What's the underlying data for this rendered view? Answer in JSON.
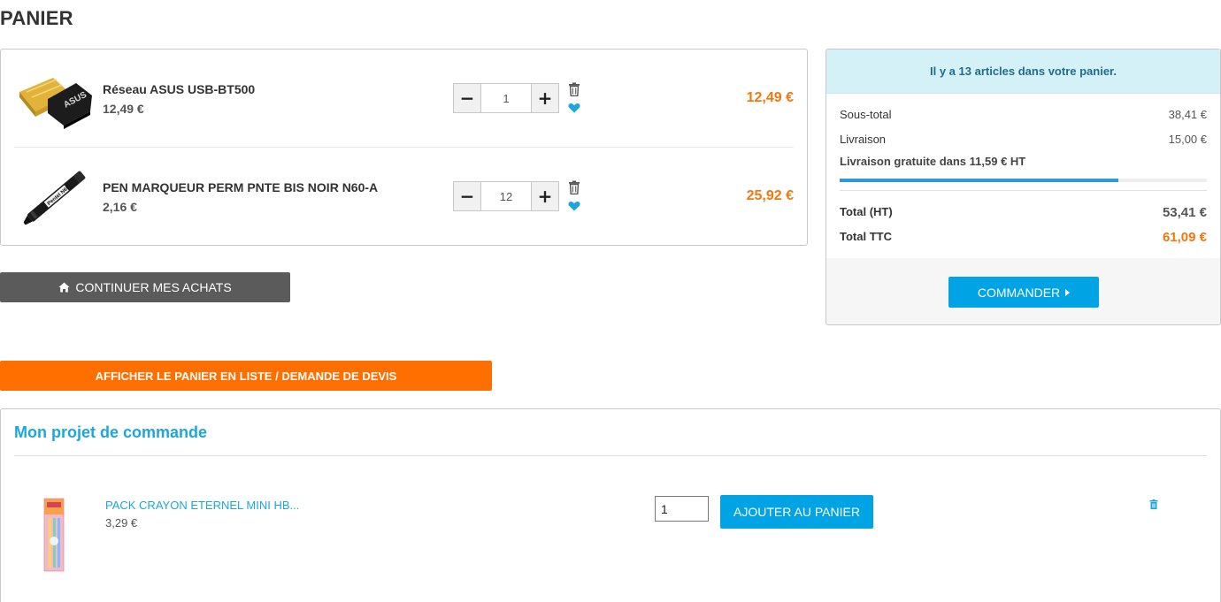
{
  "page": {
    "title": "PANIER"
  },
  "cart": {
    "items": [
      {
        "name": "Réseau ASUS USB-BT500",
        "unit_price": "12,49 €",
        "quantity": "1",
        "total": "12,49 €",
        "image": "usb-bluetooth-adapter-image"
      },
      {
        "name": "PEN MARQUEUR PERM PNTE BIS NOIR N60-A",
        "unit_price": "2,16 €",
        "quantity": "12",
        "total": "25,92 €",
        "image": "black-marker-pen-image"
      }
    ],
    "qty_minus": "−",
    "qty_plus": "+",
    "icons": {
      "delete": "trash-icon",
      "wishlist": "heart-icon"
    }
  },
  "continue_button": {
    "label": "CONTINUER MES ACHATS",
    "icon": "home-icon"
  },
  "summary": {
    "header": "Il y a 13 articles dans votre panier.",
    "subtotal_label": "Sous-total",
    "subtotal_value": "38,41 €",
    "shipping_label": "Livraison",
    "shipping_value": "15,00 €",
    "free_shipping_text": "Livraison gratuite dans 11,59 € HT",
    "free_shipping_progress": 0.76,
    "total_ht_label": "Total (HT)",
    "total_ht_value": "53,41 €",
    "total_ttc_label": "Total TTC",
    "total_ttc_value": "61,09 €",
    "order_button": "COMMANDER",
    "order_icon": "caret-right-icon"
  },
  "quote_button": {
    "label": "AFFICHER LE PANIER EN LISTE / DEMANDE DE DEVIS"
  },
  "project": {
    "title": "Mon projet de commande",
    "items": [
      {
        "name": "PACK CRAYON ETERNEL MINI HB...",
        "price": "3,29 €",
        "quantity": "1",
        "add_label": "AJOUTER AU PANIER",
        "image": "pencil-pack-image"
      }
    ]
  },
  "colors": {
    "accent_orange": "#ff6f00",
    "price_orange": "#f5760a",
    "accent_blue": "#00a4e4",
    "dark_button": "#5b5b5b"
  }
}
